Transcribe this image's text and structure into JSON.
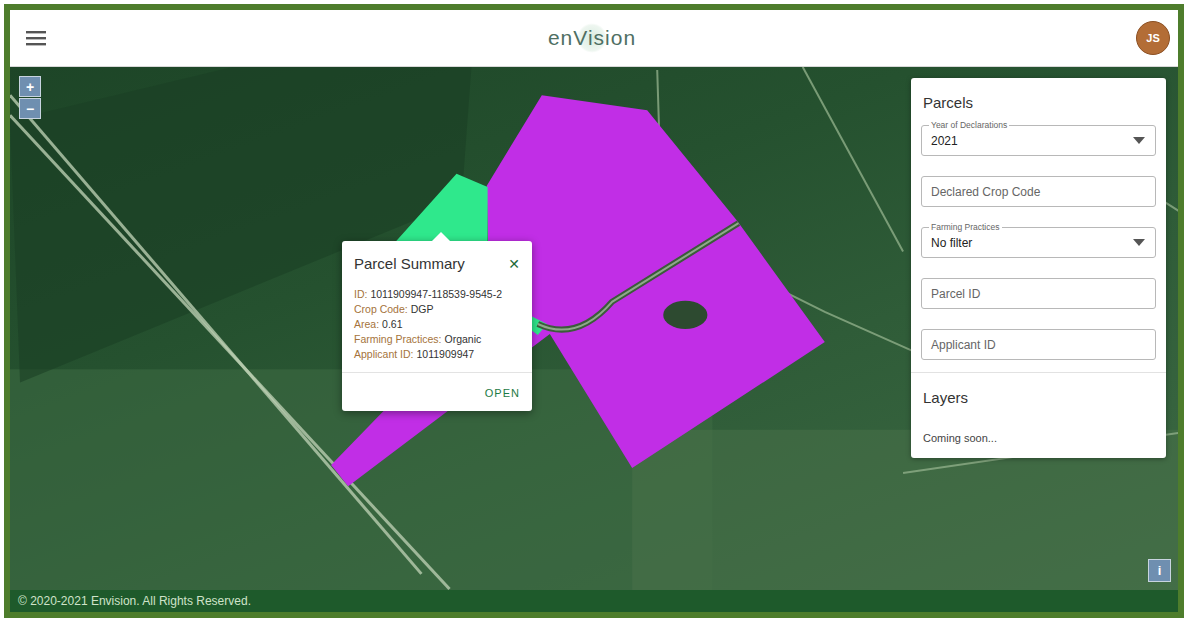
{
  "header": {
    "logo": "enVision",
    "avatar": "JS"
  },
  "zoom": {
    "in": "+",
    "out": "−"
  },
  "map": {
    "parcels": [
      {
        "color": "#c12ee6"
      },
      {
        "color": "#2fe88c"
      }
    ]
  },
  "popup": {
    "title": "Parcel Summary",
    "close": "✕",
    "fields": [
      {
        "label": "ID:",
        "value": "1011909947-118539-9545-2"
      },
      {
        "label": "Crop Code:",
        "value": "DGP"
      },
      {
        "label": "Area:",
        "value": "0.61"
      },
      {
        "label": "Farming Practices:",
        "value": "Organic"
      },
      {
        "label": "Applicant ID:",
        "value": "1011909947"
      }
    ],
    "action": "OPEN"
  },
  "panel": {
    "title": "Parcels",
    "fields": [
      {
        "kind": "select",
        "label": "Year of Declarations",
        "value": "2021"
      },
      {
        "kind": "input",
        "placeholder": "Declared Crop Code"
      },
      {
        "kind": "select",
        "label": "Farming Practices",
        "value": "No filter"
      },
      {
        "kind": "input",
        "placeholder": "Parcel ID"
      },
      {
        "kind": "input",
        "placeholder": "Applicant ID"
      }
    ],
    "layers_title": "Layers",
    "layers_note": "Coming soon..."
  },
  "info_button": "i",
  "footer": "© 2020-2021 Envision. All Rights Reserved."
}
